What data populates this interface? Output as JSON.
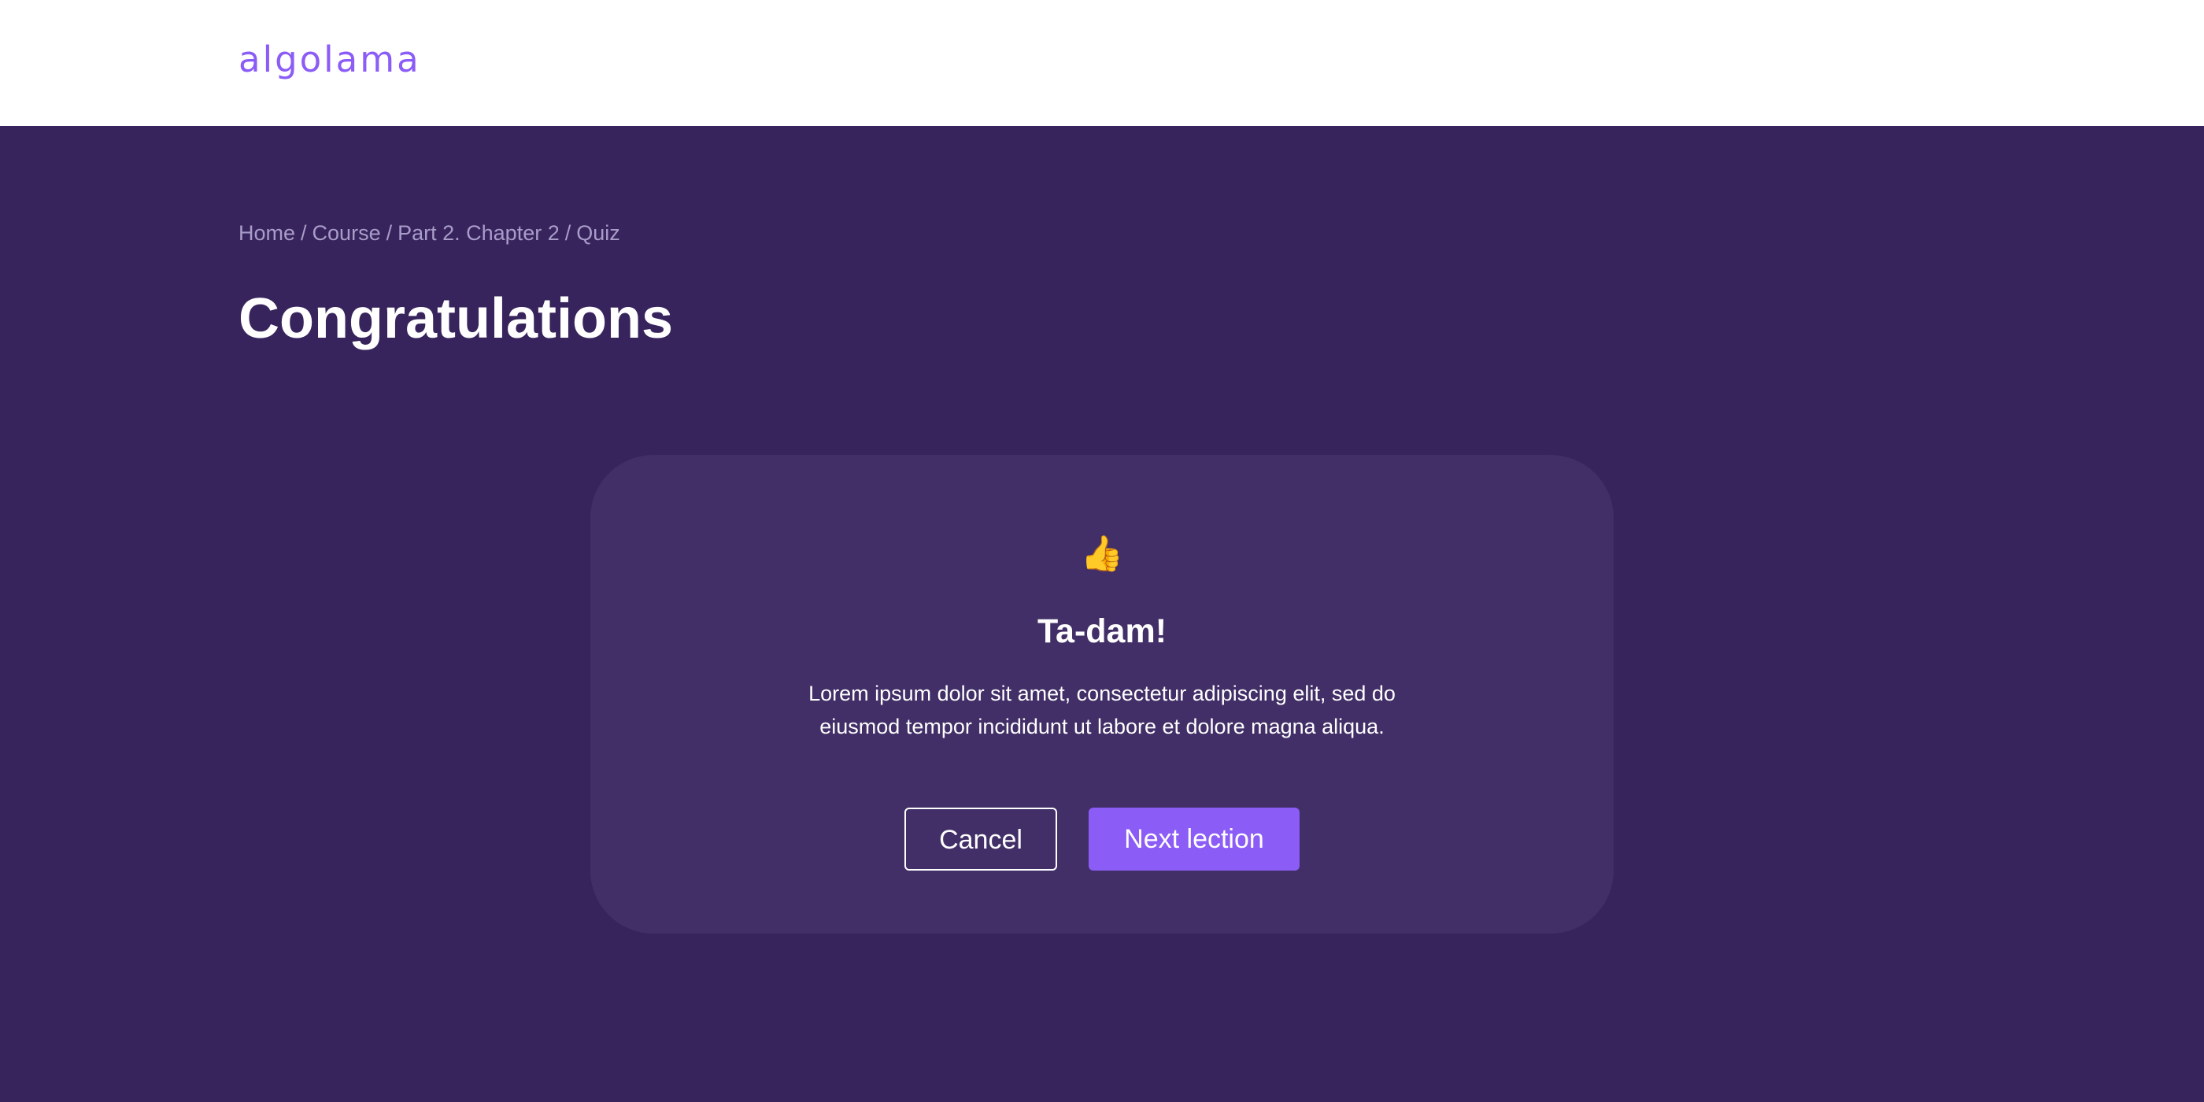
{
  "header": {
    "logo": "algolama"
  },
  "breadcrumb": {
    "items": [
      "Home",
      "Course",
      "Part 2. Chapter 2",
      "Quiz"
    ],
    "separator": "/"
  },
  "page": {
    "title": "Congratulations"
  },
  "dialog": {
    "icon": "thumbs-up-icon",
    "icon_glyph": "👍",
    "title": "Ta-dam!",
    "text_line1": "Lorem ipsum dolor sit amet, consectetur adipiscing elit, sed do",
    "text_line2": "eiusmod tempor incididunt ut labore et dolore magna aliqua.",
    "cancel_label": "Cancel",
    "next_label": "Next lection"
  },
  "colors": {
    "brand": "#8b5cf6",
    "background": "#37245c",
    "card": "#422f67",
    "header": "#ffffff"
  }
}
